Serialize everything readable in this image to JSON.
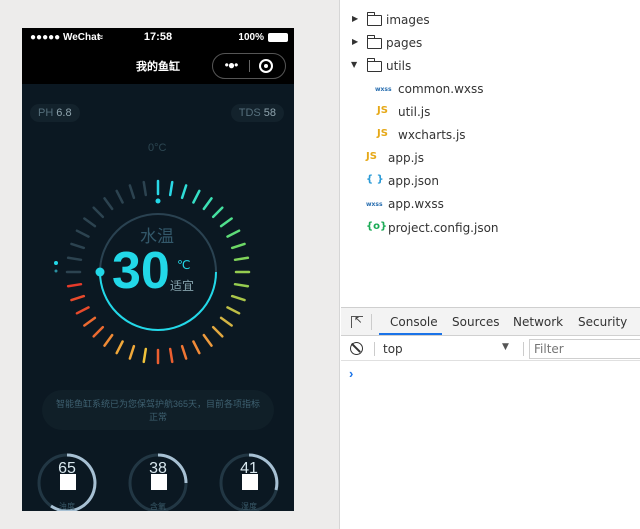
{
  "simulator": {
    "status_bar": {
      "carrier": "●●●●● WeChat",
      "time": "17:58",
      "battery": "100%"
    },
    "nav": {
      "title": "我的鱼缸",
      "more_label": "•●•"
    },
    "page": {
      "ph": {
        "label": "PH",
        "value": "6.8"
      },
      "tds": {
        "label": "TDS",
        "value": "58"
      },
      "gauge": {
        "zero_label": "0°C",
        "label": "水温",
        "value": "30",
        "unit": "℃",
        "status": "适宜"
      },
      "notice": "智能鱼缸系统已为您保驾护航365天，目前各项指标正常",
      "mini_gauges": [
        {
          "value": "65",
          "label": "浊度"
        },
        {
          "value": "38",
          "label": "含氧"
        },
        {
          "value": "41",
          "label": "湿度"
        }
      ]
    }
  },
  "file_tree": {
    "items": [
      {
        "name": "images",
        "type": "folder",
        "expanded": false
      },
      {
        "name": "pages",
        "type": "folder",
        "expanded": false
      },
      {
        "name": "utils",
        "type": "folder",
        "expanded": true
      },
      {
        "name": "common.wxss",
        "type": "wxss"
      },
      {
        "name": "util.js",
        "type": "js"
      },
      {
        "name": "wxcharts.js",
        "type": "js"
      },
      {
        "name": "app.js",
        "type": "js"
      },
      {
        "name": "app.json",
        "type": "json"
      },
      {
        "name": "app.wxss",
        "type": "wxss"
      },
      {
        "name": "project.config.json",
        "type": "config"
      }
    ],
    "icon_text": {
      "wxss": "wxss",
      "js": "JS",
      "json": "{ }",
      "config": "{o}"
    }
  },
  "console": {
    "tabs": [
      "Console",
      "Sources",
      "Network",
      "Security"
    ],
    "active_tab": "Console",
    "context": "top",
    "filter_placeholder": "Filter",
    "prompt": "›"
  }
}
